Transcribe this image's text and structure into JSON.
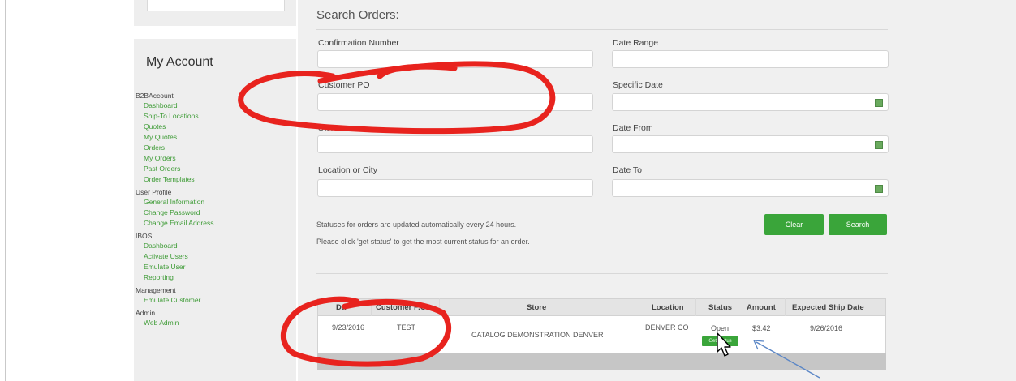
{
  "search": {
    "title": "Search Orders:",
    "fields": [
      {
        "label": "Confirmation Number",
        "value": "",
        "placeholder": ""
      },
      {
        "label": "Date Range",
        "value": "",
        "placeholder": ""
      },
      {
        "label": "Customer PO",
        "value": "",
        "placeholder": ""
      },
      {
        "label": "Specific Date",
        "value": "",
        "placeholder": ""
      },
      {
        "label": "Store",
        "value": "",
        "placeholder": ""
      },
      {
        "label": "Date From",
        "value": "",
        "placeholder": ""
      },
      {
        "label": "Location or City",
        "value": "",
        "placeholder": ""
      },
      {
        "label": "Date To",
        "value": "",
        "placeholder": ""
      }
    ],
    "note_1": "Statuses for orders are updated automatically every 24 hours.",
    "note_2": "Please click 'get status' to get the most current status for an order.",
    "clear_label": "Clear",
    "search_label": "Search"
  },
  "sidebar": {
    "title": "My Account",
    "groups": [
      {
        "head": "B2BAccount",
        "items": [
          "Dashboard",
          "Ship-To Locations",
          "Quotes",
          "My Quotes",
          "Orders",
          "My Orders",
          "Past Orders",
          "Order Templates"
        ]
      },
      {
        "head": "User Profile",
        "items": [
          "General Information",
          "Change Password",
          "Change Email Address"
        ]
      },
      {
        "head": "IBOS",
        "items": [
          "Dashboard",
          "Activate Users",
          "Emulate User",
          "Reporting"
        ]
      },
      {
        "head": "Management",
        "items": [
          "Emulate Customer"
        ]
      },
      {
        "head": "Admin",
        "items": [
          "Web Admin"
        ]
      }
    ]
  },
  "table": {
    "columns": [
      "Da",
      "Customer P.O.",
      "Store",
      "Location",
      "Status",
      "Amount",
      "Expected Ship Date"
    ],
    "rows": [
      {
        "date": "9/23/2016",
        "po": "TEST",
        "store": "CATALOG DEMONSTRATION DENVER",
        "location": "DENVER CO",
        "status": "Open",
        "amount": "$3.42",
        "ship_date": "9/26/2016",
        "get_status_label": "Get Status"
      }
    ]
  },
  "colors": {
    "accent": "#3aa53a",
    "annotation_red": "#e8231e",
    "annotation_arrow": "#5a86c6",
    "link": "#3d9b35"
  }
}
